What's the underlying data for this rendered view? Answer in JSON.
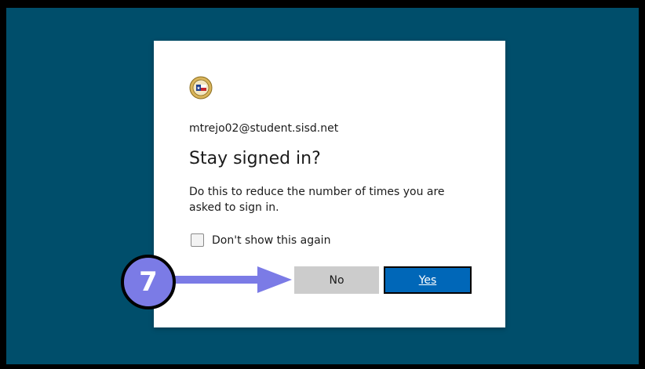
{
  "signin": {
    "account": "mtrejo02@student.sisd.net",
    "title": "Stay signed in?",
    "description": "Do this to reduce the number of times you are asked to sign in.",
    "checkbox_label": "Don't show this again",
    "no_label": "No",
    "yes_label": "Yes"
  },
  "annotation": {
    "step_number": "7"
  },
  "colors": {
    "backdrop": "#004e6b",
    "card": "#ffffff",
    "yes_button": "#0067b8",
    "no_button": "#cccccc",
    "callout": "#7b7be6"
  },
  "icons": {
    "logo": "school-district-seal-icon",
    "arrow": "right-arrow-icon"
  }
}
